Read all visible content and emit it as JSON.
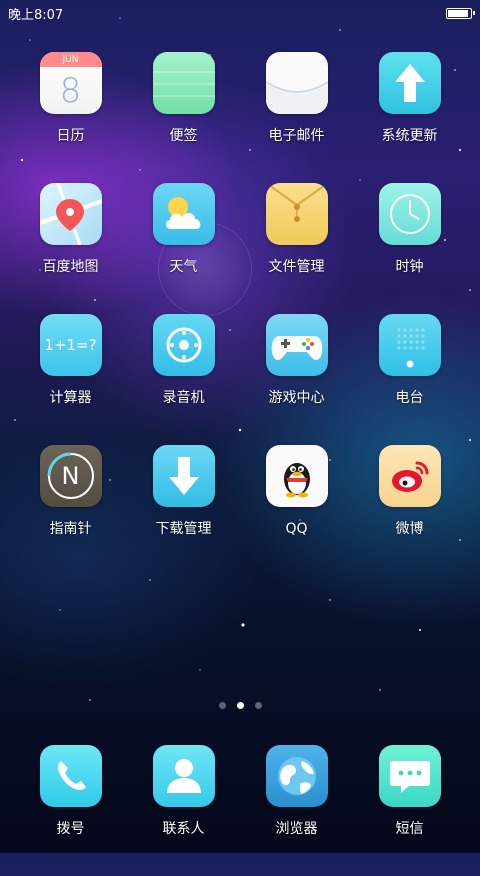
{
  "status_bar": {
    "time": "晚上8:07",
    "battery_level": 1.0
  },
  "apps": [
    {
      "label": "日历",
      "icon": "calendar-icon",
      "month": "JUN",
      "day": "8"
    },
    {
      "label": "便签",
      "icon": "notes-icon"
    },
    {
      "label": "电子邮件",
      "icon": "email-icon"
    },
    {
      "label": "系统更新",
      "icon": "system-update-icon"
    },
    {
      "label": "百度地图",
      "icon": "map-icon"
    },
    {
      "label": "天气",
      "icon": "weather-icon"
    },
    {
      "label": "文件管理",
      "icon": "file-manager-icon"
    },
    {
      "label": "时钟",
      "icon": "clock-icon"
    },
    {
      "label": "计算器",
      "icon": "calculator-icon",
      "formula": "1+1=?"
    },
    {
      "label": "录音机",
      "icon": "recorder-icon"
    },
    {
      "label": "游戏中心",
      "icon": "game-center-icon"
    },
    {
      "label": "电台",
      "icon": "radio-icon"
    },
    {
      "label": "指南针",
      "icon": "compass-icon",
      "letter": "N"
    },
    {
      "label": "下载管理",
      "icon": "download-manager-icon"
    },
    {
      "label": "QQ",
      "icon": "qq-penguin-icon"
    },
    {
      "label": "微博",
      "icon": "weibo-icon"
    }
  ],
  "page_indicator": {
    "count": 3,
    "active": 1
  },
  "dock": [
    {
      "label": "拨号",
      "icon": "phone-icon"
    },
    {
      "label": "联系人",
      "icon": "contacts-icon"
    },
    {
      "label": "浏览器",
      "icon": "browser-globe-icon"
    },
    {
      "label": "短信",
      "icon": "message-icon"
    }
  ],
  "colors": {
    "icon_blue": "#56c8f0",
    "icon_green": "#7ee6b8",
    "icon_yellow": "#f6d978",
    "weibo_red": "#e6162d"
  }
}
